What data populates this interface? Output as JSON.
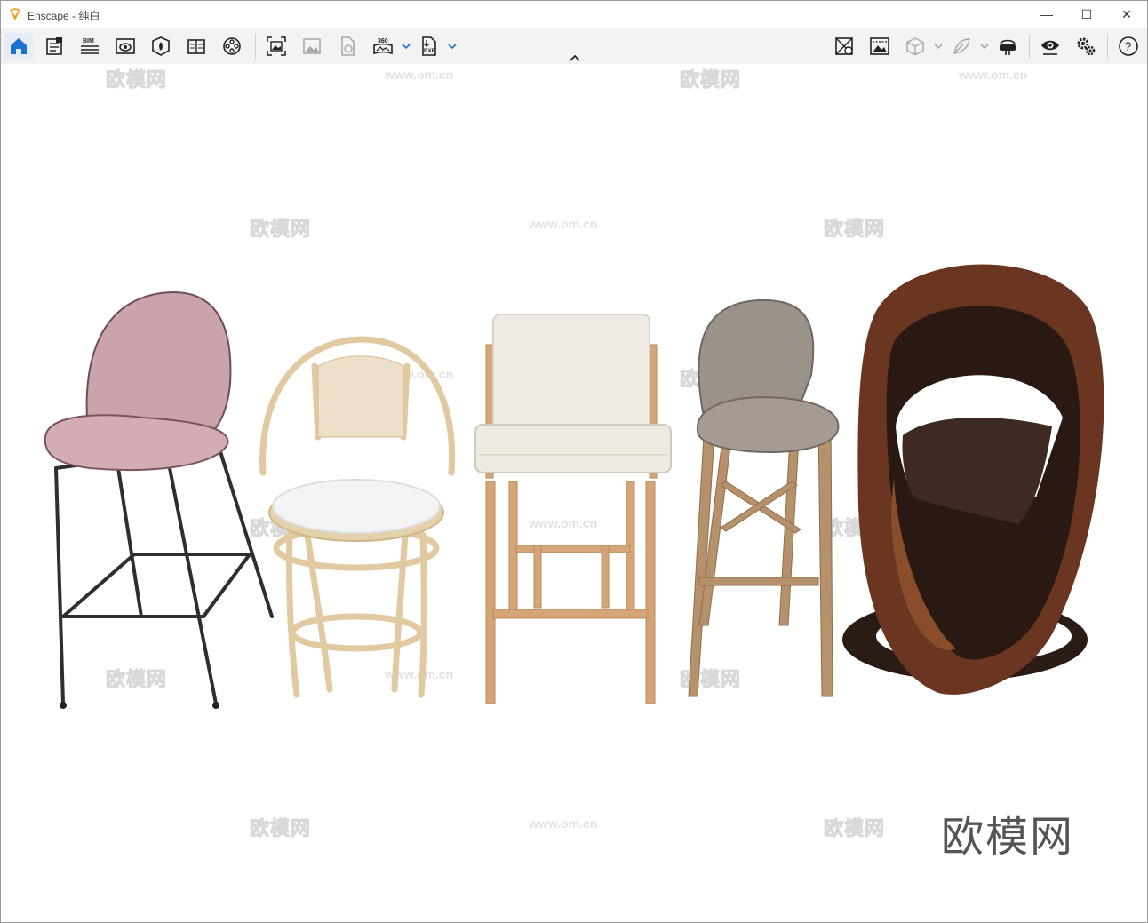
{
  "window": {
    "app_name": "Enscape",
    "title_separator": " - ",
    "project_name": "纯白",
    "controls": {
      "minimize": "—",
      "maximize": "☐",
      "close": "✕"
    }
  },
  "toolbar": {
    "left_icons": [
      "home-icon",
      "view-management-icon",
      "bim-icon",
      "visual-settings-icon",
      "asset-library-icon",
      "material-editor-icon",
      "video-editor-icon",
      "screenshot-icon",
      "batch-render-icon",
      "upload-icon",
      "panorama-360-icon",
      "export-exe-icon"
    ],
    "bim_label": "BIM",
    "panorama_label": "360",
    "exe_label": "EXE",
    "right_icons": [
      "site-context-icon",
      "atmosphere-icon",
      "sketch-view-icon",
      "feedback-icon",
      "vr-headset-icon",
      "view-icon",
      "settings-icon",
      "help-icon"
    ],
    "help_label": "?",
    "accent_color": "#1f6fd1"
  },
  "viewport": {
    "watermark_text": "欧模网",
    "watermark_url": "www.om.cn",
    "brand_watermark": "欧模网",
    "objects": [
      "pink-upholstered-bar-stool",
      "rattan-swivel-counter-stool",
      "cream-fabric-wood-bar-stool",
      "grey-fabric-oak-bar-stool",
      "brown-leather-sculptural-chair"
    ]
  }
}
